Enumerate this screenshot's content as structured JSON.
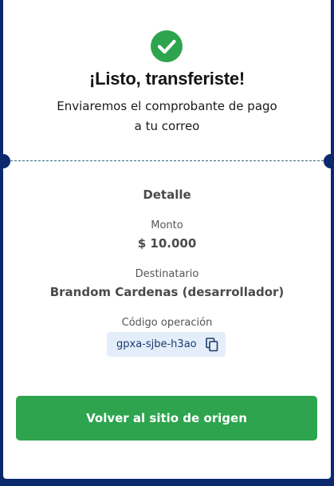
{
  "success": {
    "icon": "check-circle-icon",
    "title": "¡Listo, transferiste!",
    "message_line1": "Enviaremos el comprobante de pago",
    "message_line2": "a tu correo"
  },
  "detail": {
    "heading": "Detalle",
    "amount_label": "Monto",
    "amount_value": "$ 10.000",
    "recipient_label": "Destinatario",
    "recipient_value": "Brandom Cardenas (desarrollador)",
    "operation_label": "Código operación",
    "operation_code": "gpxa-sjbe-h3ao",
    "copy_icon": "copy-icon"
  },
  "actions": {
    "return_label": "Volver al sitio de origen"
  },
  "colors": {
    "background": "#0b2a6e",
    "success_green": "#2ea44f",
    "chip_bg": "#e4eefb"
  }
}
